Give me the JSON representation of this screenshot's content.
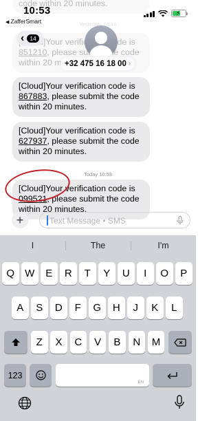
{
  "status_bar": {
    "time": "10:53",
    "back_app": "ZafferSmart"
  },
  "header": {
    "back_badge": "14",
    "contact": "+32 475 16 18 00"
  },
  "messages": {
    "top_fragment": "code within 20 minutes.",
    "top_timestamp": "Yesterday 10:16",
    "m1": {
      "pre": "[Cloud]Your verification code is ",
      "code": "851210",
      "post": ", please submit the code within 20 minutes."
    },
    "m2": {
      "pre": "[Cloud]Your verification code is ",
      "code": "867883",
      "post": ", please submit the code within 20 minutes."
    },
    "m3": {
      "pre": "[Cloud]Your verification code is ",
      "code": "627937",
      "post": ", please submit the code within 20 minutes."
    },
    "today_timestamp": "Today 10:53",
    "m4": {
      "pre": "[Cloud]Your verification code is ",
      "code": "099521",
      "post": ", please submit the code within 20 minutes."
    }
  },
  "input": {
    "placeholder": "Text Message • SMS"
  },
  "keyboard": {
    "suggestions": [
      "I",
      "The",
      "I'm"
    ],
    "row1": [
      "Q",
      "W",
      "E",
      "R",
      "T",
      "Y",
      "U",
      "I",
      "O",
      "P"
    ],
    "row2": [
      "A",
      "S",
      "D",
      "F",
      "G",
      "H",
      "J",
      "K",
      "L"
    ],
    "row3": [
      "Z",
      "X",
      "C",
      "V",
      "B",
      "N",
      "M"
    ],
    "numbers_key": "123",
    "space_hint": "EN"
  },
  "colors": {
    "bubble": "#e9e9eb",
    "annotation": "#c0222a",
    "caret": "#2d7cf6",
    "keyboard_bg": "#d1d3d8"
  }
}
